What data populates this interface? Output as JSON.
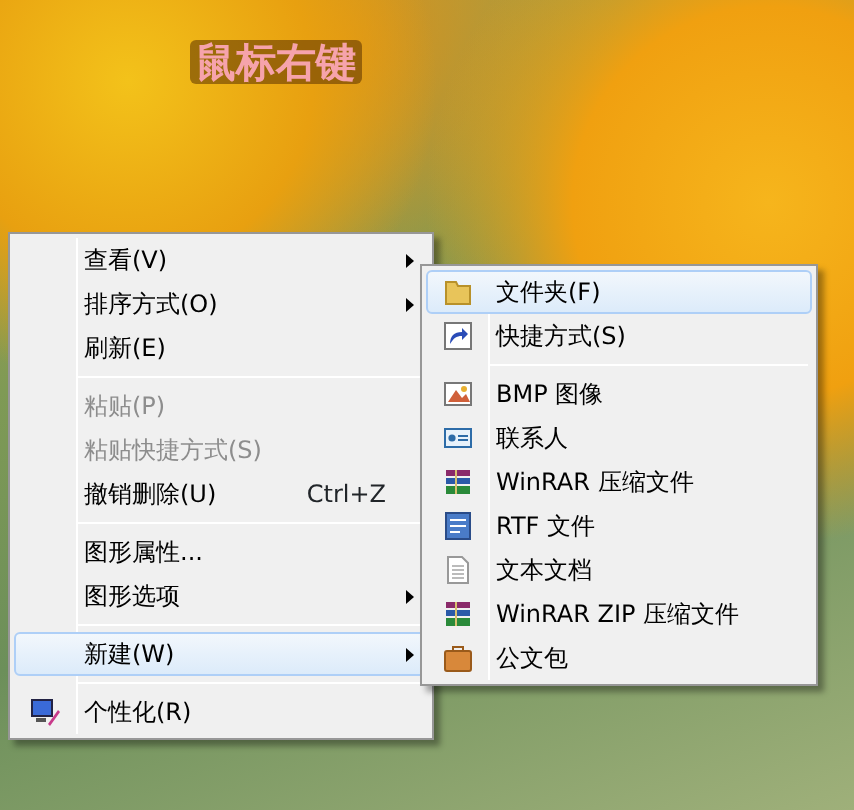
{
  "caption": "鼠标右键",
  "context_menu": {
    "items": [
      {
        "kind": "item",
        "label": "查看(V)",
        "has_submenu": true,
        "disabled": false,
        "selected": false
      },
      {
        "kind": "item",
        "label": "排序方式(O)",
        "has_submenu": true,
        "disabled": false,
        "selected": false
      },
      {
        "kind": "item",
        "label": "刷新(E)",
        "has_submenu": false,
        "disabled": false,
        "selected": false
      },
      {
        "kind": "separator"
      },
      {
        "kind": "item",
        "label": "粘贴(P)",
        "has_submenu": false,
        "disabled": true,
        "selected": false
      },
      {
        "kind": "item",
        "label": "粘贴快捷方式(S)",
        "has_submenu": false,
        "disabled": true,
        "selected": false
      },
      {
        "kind": "item",
        "label": "撤销删除(U)",
        "shortcut": "Ctrl+Z",
        "has_submenu": false,
        "disabled": false,
        "selected": false
      },
      {
        "kind": "separator"
      },
      {
        "kind": "item",
        "label": "图形属性...",
        "has_submenu": false,
        "disabled": false,
        "selected": false
      },
      {
        "kind": "item",
        "label": "图形选项",
        "has_submenu": true,
        "disabled": false,
        "selected": false
      },
      {
        "kind": "separator"
      },
      {
        "kind": "item",
        "label": "新建(W)",
        "has_submenu": true,
        "disabled": false,
        "selected": true
      },
      {
        "kind": "separator"
      },
      {
        "kind": "item",
        "label": "个性化(R)",
        "has_submenu": false,
        "disabled": false,
        "selected": false
      }
    ]
  },
  "new_submenu": {
    "items": [
      {
        "kind": "item",
        "label": "文件夹(F)",
        "selected": true
      },
      {
        "kind": "item",
        "label": "快捷方式(S)",
        "selected": false
      },
      {
        "kind": "separator"
      },
      {
        "kind": "item",
        "label": "BMP 图像",
        "selected": false
      },
      {
        "kind": "item",
        "label": "联系人",
        "selected": false
      },
      {
        "kind": "item",
        "label": "WinRAR 压缩文件",
        "selected": false
      },
      {
        "kind": "item",
        "label": "RTF 文件",
        "selected": false
      },
      {
        "kind": "item",
        "label": "文本文档",
        "selected": false
      },
      {
        "kind": "item",
        "label": "WinRAR ZIP 压缩文件",
        "selected": false
      },
      {
        "kind": "item",
        "label": "公文包",
        "selected": false
      }
    ]
  }
}
